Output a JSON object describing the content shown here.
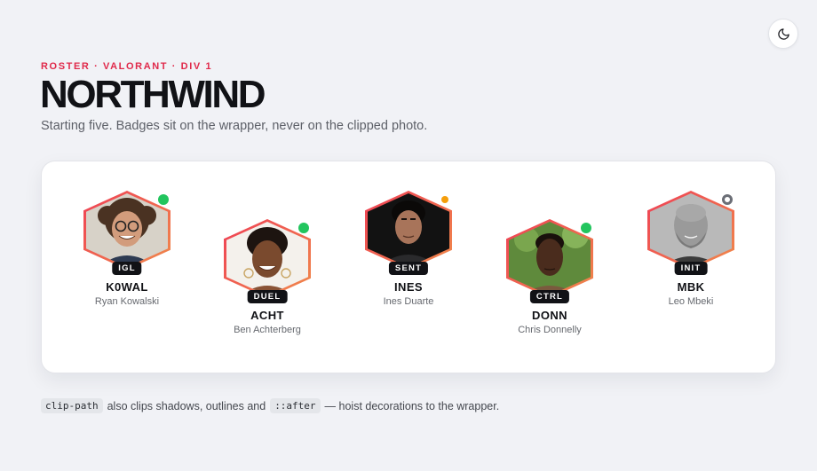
{
  "header": {
    "eyebrow": "ROSTER · VALORANT · DIV 1",
    "title": "NORTHWIND",
    "subtitle": "Starting five. Badges sit on the wrapper, never on the clipped photo."
  },
  "theme_toggle": {
    "icon": "moon-icon"
  },
  "colors": {
    "accent": "#e0294a",
    "hex_border_start": "#ef3f55",
    "hex_border_end": "#f08a4b",
    "status_online": "#22c55e",
    "status_away": "#f59e0b",
    "status_offline": "#6b6e76"
  },
  "players": [
    {
      "tag": "K0WAL",
      "name": "Ryan Kowalski",
      "role": "IGL",
      "status": "online"
    },
    {
      "tag": "ACHT",
      "name": "Ben Achterberg",
      "role": "DUEL",
      "status": "online"
    },
    {
      "tag": "INES",
      "name": "Ines Duarte",
      "role": "SENT",
      "status": "away"
    },
    {
      "tag": "DONN",
      "name": "Chris Donnelly",
      "role": "CTRL",
      "status": "online"
    },
    {
      "tag": "MBK",
      "name": "Leo Mbeki",
      "role": "INIT",
      "status": "offline"
    }
  ],
  "footnote": {
    "code1": "clip-path",
    "text1": "also clips shadows, outlines and",
    "code2": "::after",
    "text2": "— hoist decorations to the wrapper."
  }
}
